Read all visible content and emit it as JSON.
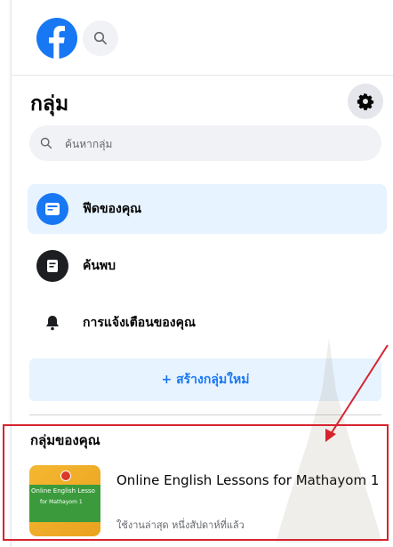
{
  "header": {
    "logo_icon": "facebook-logo-icon",
    "search_icon": "search-icon"
  },
  "sidebar": {
    "title": "กลุ่ม",
    "settings_icon": "gear-icon",
    "search": {
      "placeholder": "ค้นหากลุ่ม",
      "value": ""
    },
    "items": [
      {
        "label": "ฟีดของคุณ",
        "icon": "feed-icon",
        "active": true
      },
      {
        "label": "ค้นพบ",
        "icon": "discover-icon",
        "active": false
      },
      {
        "label": "การแจ้งเตือนของคุณ",
        "icon": "bell-icon",
        "active": false
      }
    ],
    "create_button": "+ สร้างกลุ่มใหม่"
  },
  "your_groups": {
    "title": "กลุ่มของคุณ",
    "groups": [
      {
        "name": "Online English Lessons for Mathayom 1",
        "meta": "ใช้งานล่าสุด หนึ่งสัปดาห์ที่แล้ว",
        "thumbnail_text_1": "Online English Lesso",
        "thumbnail_text_2": "for Mathayom 1"
      }
    ]
  },
  "colors": {
    "brand": "#1877f2",
    "active_bg": "#e7f3ff",
    "annotation": "#d6232f"
  }
}
